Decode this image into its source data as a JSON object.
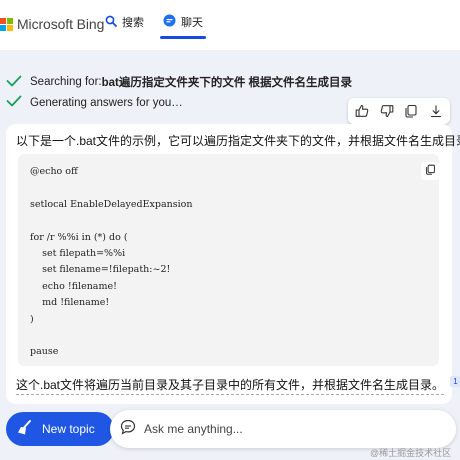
{
  "header": {
    "brand": "Microsoft Bing",
    "logo_colors": [
      "#f25022",
      "#7fba00",
      "#00a4ef",
      "#ffb900"
    ],
    "tabs": [
      {
        "label": "搜索",
        "icon": "search-icon"
      },
      {
        "label": "聊天",
        "icon": "chat-bubble-icon",
        "active": true
      }
    ],
    "accent": "#174ae4"
  },
  "status": [
    {
      "prefix": "Searching for: ",
      "query": "bat遍历指定文件夹下的文件 根据文件名生成目录",
      "icon": "check-icon"
    },
    {
      "prefix": "Generating answers for you…",
      "query": "",
      "icon": "check-icon"
    }
  ],
  "status_color": "#17a05d",
  "actions": [
    {
      "name": "like",
      "icon": "thumbs-up-icon"
    },
    {
      "name": "dislike",
      "icon": "thumbs-down-icon"
    },
    {
      "name": "copy",
      "icon": "copy-icon"
    },
    {
      "name": "export",
      "icon": "download-icon"
    }
  ],
  "answer": {
    "intro": "以下是一个.bat文件的示例，它可以遍历指定文件夹下的文件，并根据文件名生成目录：",
    "code": [
      "@echo off",
      "",
      "setlocal EnableDelayedExpansion",
      "",
      "for /r %%i in (*) do (",
      "    set filepath=%%i",
      "    set filename=!filepath:~2!",
      "    echo !filename!",
      "    md !filename!",
      ")",
      "",
      "pause"
    ],
    "summary": "这个.bat文件将遍历当前目录及其子目录中的所有文件，并根据文件名生成目录。",
    "citation": "1"
  },
  "bottom": {
    "new_topic_label": "New topic",
    "new_topic_color": "#1f57e4",
    "ask_placeholder": "Ask me anything..."
  },
  "watermark": "@稀土掘金技术社区"
}
